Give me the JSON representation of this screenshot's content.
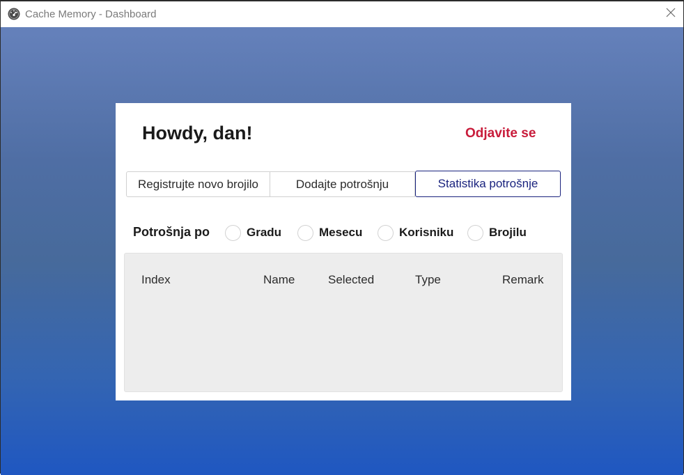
{
  "window": {
    "title": "Cache Memory - Dashboard",
    "icons": {
      "app": "gauge-icon",
      "close": "close-icon"
    }
  },
  "header": {
    "greeting": "Howdy, dan!",
    "logout_label": "Odjavite se"
  },
  "tabs": [
    {
      "label": "Registrujte novo brojilo",
      "selected": false
    },
    {
      "label": "Dodajte potrošnju",
      "selected": false
    },
    {
      "label": "Statistika potrošnje",
      "selected": true
    }
  ],
  "filter": {
    "label": "Potrošnja po",
    "options": [
      {
        "label": "Gradu",
        "checked": false
      },
      {
        "label": "Mesecu",
        "checked": false
      },
      {
        "label": "Korisniku",
        "checked": false
      },
      {
        "label": "Brojilu",
        "checked": false
      }
    ]
  },
  "table": {
    "columns": [
      "Index",
      "Name",
      "Selected",
      "Type",
      "Remark"
    ],
    "rows": []
  },
  "colors": {
    "accent": "#1a237e",
    "logout": "#c81b3a",
    "background_top": "#6581bb",
    "background_bottom": "#1f57c1"
  }
}
